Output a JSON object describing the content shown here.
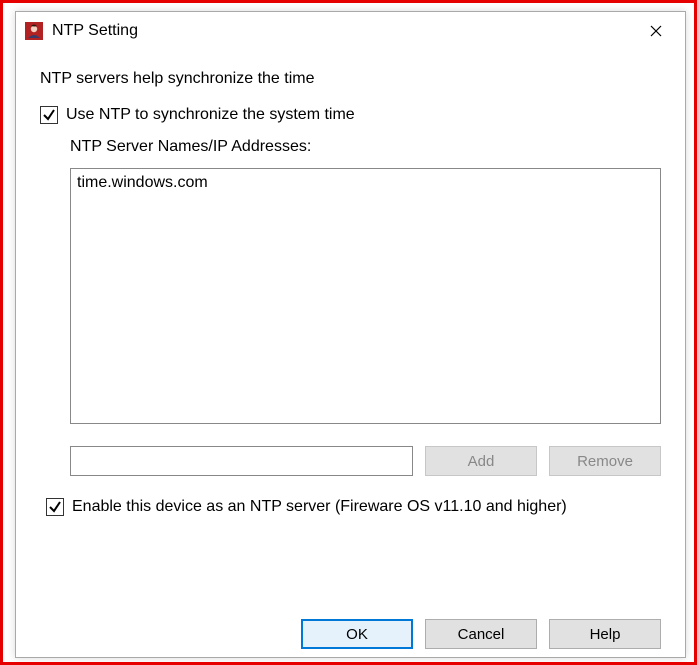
{
  "window": {
    "title": "NTP Setting"
  },
  "intro": "NTP servers help synchronize the time",
  "useNtp": {
    "label": "Use NTP to synchronize the system time",
    "checked": true
  },
  "serverList": {
    "label": "NTP Server Names/IP Addresses:",
    "items": [
      "time.windows.com"
    ]
  },
  "newServer": {
    "value": ""
  },
  "buttons": {
    "add": "Add",
    "remove": "Remove",
    "ok": "OK",
    "cancel": "Cancel",
    "help": "Help"
  },
  "enableServer": {
    "label": "Enable this device as an NTP server (Fireware OS v11.10 and higher)",
    "checked": true
  }
}
